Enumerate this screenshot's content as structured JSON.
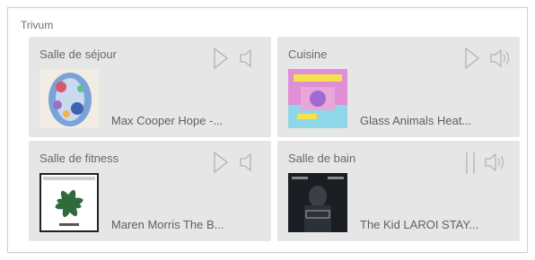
{
  "group": {
    "title": "Trivum"
  },
  "rooms": [
    {
      "name": "Salle de séjour",
      "track": "Max Cooper Hope -...",
      "state": "play-icon",
      "volume": "speaker-muted-icon"
    },
    {
      "name": "Cuisine",
      "track": "Glass Animals Heat...",
      "state": "play-icon",
      "volume": "speaker-on-icon"
    },
    {
      "name": "Salle de fitness",
      "track": "Maren Morris The B...",
      "state": "play-icon",
      "volume": "speaker-muted-icon"
    },
    {
      "name": "Salle de bain",
      "track": "The Kid LAROI STAY...",
      "state": "pause-icon",
      "volume": "speaker-on-icon"
    }
  ],
  "colors": {
    "card": "#e6e6e6",
    "icon": "#b5b5b5",
    "text": "#606060"
  }
}
